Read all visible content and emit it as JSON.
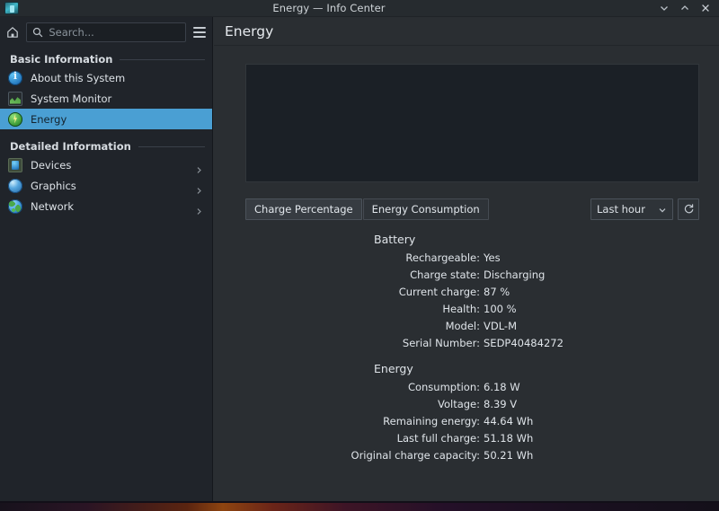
{
  "window": {
    "title": "Energy — Info Center",
    "app_icon": "info-center-icon",
    "controls": [
      {
        "name": "minimize",
        "glyph": "v"
      },
      {
        "name": "maximize",
        "glyph": "^"
      },
      {
        "name": "close",
        "glyph": "x"
      }
    ]
  },
  "sidebar": {
    "home_icon": "home-icon",
    "search": {
      "icon": "search-icon",
      "placeholder": "Search...",
      "value": ""
    },
    "menu_icon": "hamburger-menu-icon",
    "sections": [
      {
        "label": "Basic Information",
        "items": [
          {
            "label": "About this System",
            "icon": "info-icon",
            "selected": false,
            "has_chevron": false
          },
          {
            "label": "System Monitor",
            "icon": "system-monitor-icon",
            "selected": false,
            "has_chevron": false
          },
          {
            "label": "Energy",
            "icon": "energy-icon",
            "selected": true,
            "has_chevron": false
          }
        ]
      },
      {
        "label": "Detailed Information",
        "items": [
          {
            "label": "Devices",
            "icon": "devices-icon",
            "selected": false,
            "has_chevron": true
          },
          {
            "label": "Graphics",
            "icon": "graphics-icon",
            "selected": false,
            "has_chevron": true
          },
          {
            "label": "Network",
            "icon": "network-icon",
            "selected": false,
            "has_chevron": true
          }
        ]
      }
    ]
  },
  "content": {
    "page_title": "Energy",
    "chart": {
      "empty": true
    },
    "toolbar": {
      "tabs": [
        {
          "label": "Charge Percentage",
          "active": true
        },
        {
          "label": "Energy Consumption",
          "active": false
        }
      ],
      "range_select": {
        "value": "Last hour",
        "icon": "chevron-down-icon"
      },
      "refresh_icon": "refresh-icon"
    },
    "groups": [
      {
        "title": "Battery",
        "rows": [
          {
            "label": "Rechargeable:",
            "value": "Yes"
          },
          {
            "label": "Charge state:",
            "value": "Discharging"
          },
          {
            "label": "Current charge:",
            "value": "87 %"
          },
          {
            "label": "Health:",
            "value": "100 %"
          },
          {
            "label": "Model:",
            "value": "VDL-M"
          },
          {
            "label": "Serial Number:",
            "value": "SEDP40484272"
          }
        ]
      },
      {
        "title": "Energy",
        "rows": [
          {
            "label": "Consumption:",
            "value": "6.18 W"
          },
          {
            "label": "Voltage:",
            "value": "8.39 V"
          },
          {
            "label": "Remaining energy:",
            "value": "44.64 Wh"
          },
          {
            "label": "Last full charge:",
            "value": "51.18 Wh"
          },
          {
            "label": "Original charge capacity:",
            "value": "50.21 Wh"
          }
        ]
      }
    ]
  },
  "colors": {
    "accent": "#4a9fd3",
    "window_bg": "#2a2e32",
    "sidebar_bg": "#20242a",
    "titlebar_bg": "#262b2f",
    "text": "#dfe4e9",
    "chart_bg": "#1b2026"
  }
}
